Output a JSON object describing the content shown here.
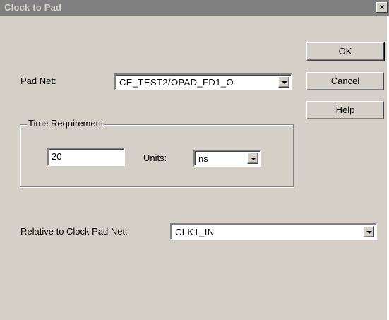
{
  "window": {
    "title": "Clock to Pad",
    "close_glyph": "×"
  },
  "buttons": {
    "ok": "OK",
    "cancel": "Cancel",
    "help_prefix": "",
    "help_mnemonic": "H",
    "help_rest": "elp"
  },
  "pad_net": {
    "label": "Pad Net:",
    "value": "CE_TEST2/OPAD_FD1_O"
  },
  "time_requirement": {
    "group_label": "Time Requirement",
    "value": "20",
    "units_label": "Units:",
    "units_value": "ns"
  },
  "relative_clock": {
    "label": "Relative to Clock Pad Net:",
    "value": "CLK1_IN"
  },
  "icons": {
    "dropdown": "chevron-down-icon"
  }
}
